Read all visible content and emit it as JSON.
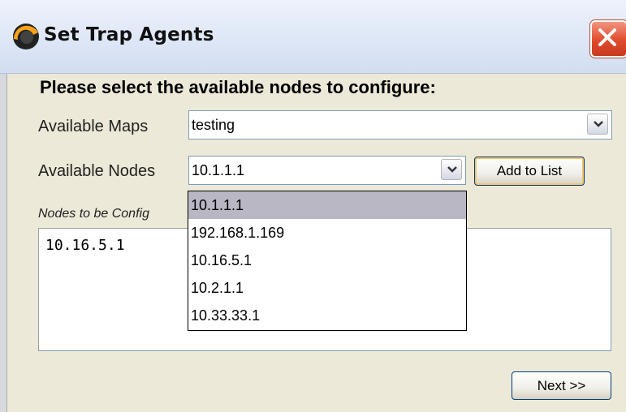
{
  "window": {
    "title": "Set Trap Agents"
  },
  "form": {
    "instruction": "Please select the available nodes to configure:",
    "maps_label": "Available Maps",
    "maps_value": "testing",
    "nodes_label": "Available Nodes",
    "nodes_value": "10.1.1.1",
    "add_button": "Add to List",
    "configured_label": "Nodes to be Config",
    "configured_value": "10.16.5.1",
    "next_button": "Next >>"
  },
  "node_options": [
    "10.1.1.1",
    "192.168.1.169",
    "10.16.5.1",
    "10.2.1.1",
    "10.33.33.1"
  ],
  "colors": {
    "selected_option": "#b8b7c3",
    "close_button": "#e04b2d"
  }
}
